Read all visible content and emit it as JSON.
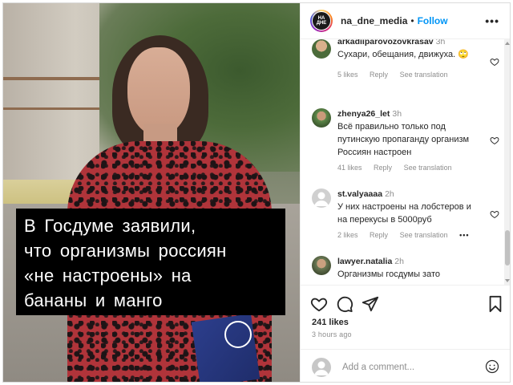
{
  "post": {
    "caption_lines": [
      "В Госдуме заявили,",
      "что организмы россиян",
      "«не настроены» на",
      "бананы и манго"
    ]
  },
  "header": {
    "avatar_text_top": "НА",
    "avatar_text_bottom": "ДНЕ",
    "username": "na_dne_media",
    "separator": "•",
    "follow_label": "Follow",
    "more_label": "•••"
  },
  "comments": [
    {
      "username": "arkadiiparovozovkrasav",
      "time": "3h",
      "text": "Сухари, обещания, движуха. 🙄",
      "likes": "5 likes",
      "reply": "Reply",
      "translate": "See translation"
    },
    {
      "username": "zhenya26_let",
      "time": "3h",
      "text": "Всё правильно только под путинскую пропаганду организм Россиян настроен",
      "likes": "41 likes",
      "reply": "Reply",
      "translate": "See translation"
    },
    {
      "username": "st.valyaaaa",
      "time": "2h",
      "text": "У них настроены на лобстеров и на перекусы в 5000руб",
      "likes": "2 likes",
      "reply": "Reply",
      "translate": "See translation",
      "options": "•••"
    },
    {
      "username": "lawyer.natalia",
      "time": "2h",
      "text": "Организмы госдумы зато настроены о росскошь так",
      "likes": "",
      "reply": "",
      "translate": ""
    }
  ],
  "actions": {
    "like_icon": "heart-icon",
    "comment_icon": "comment-icon",
    "share_icon": "paper-plane-icon",
    "save_icon": "bookmark-icon",
    "likes_count": "241 likes",
    "time_ago": "3 hours ago"
  },
  "add_comment": {
    "placeholder": "Add a comment...",
    "emoji_icon": "smiley-icon"
  },
  "colors": {
    "link_blue": "#0095f6",
    "text": "#262626",
    "muted": "#8e8e8e",
    "caption_bg": "#000000"
  }
}
